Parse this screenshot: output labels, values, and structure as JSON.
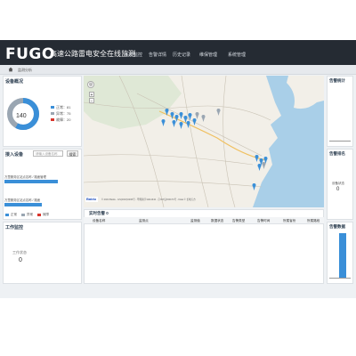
{
  "header": {
    "logo": "FUGO",
    "app_title": "高速公路雷电安全在线监测",
    "nav_items": [
      "系统监控",
      "告警详情",
      "历史记录",
      "维保管理",
      "系统管理"
    ]
  },
  "breadcrumb": {
    "label": "监测分析"
  },
  "device_overview": {
    "title": "设备概况",
    "total": "140",
    "legend": [
      {
        "label": "正常：81",
        "color": "#3a8fd8"
      },
      {
        "label": "异常：75",
        "color": "#9aa6b2"
      },
      {
        "label": "故障：20",
        "color": "#d9342b"
      }
    ],
    "donut_fraction": 0.58
  },
  "access_devices": {
    "title": "接入设备",
    "input_placeholder": "请输入设备名称",
    "search_label": "搜索",
    "rows": [
      {
        "label": "万里服务区站点名称 / 路面管理",
        "value_fraction": 1.0
      },
      {
        "label": "万里服务区站点名称 / 路面",
        "value_fraction": 0.7
      }
    ],
    "legend": [
      {
        "label": "正常",
        "color": "#3a8fd8"
      },
      {
        "label": "异常",
        "color": "#9aa6b2"
      },
      {
        "label": "故障",
        "color": "#d9342b"
      }
    ]
  },
  "work_status": {
    "title": "工作监控",
    "label": "工作状态",
    "value": "0"
  },
  "map": {
    "zoom_in": "+",
    "zoom_out": "−",
    "brand": "Baidu",
    "copyright": "© 2024 Baidu - GS(2023)3206号 - 甲测资字11111342 - 京ICP证030173号 - Data © 长地万方"
  },
  "realtime_table": {
    "title": "实时告警 0",
    "columns": [
      "设备名称",
      "监测点",
      "监测值",
      "数据状态",
      "告警类型",
      "告警时间",
      "所属省份",
      "所属路段"
    ]
  },
  "right_panels": {
    "alarm_count_title": "告警统计",
    "alarm_rank_title": "告警排名",
    "device_status_label": "设备状态",
    "device_status_value": "0",
    "alarm_chart_title": "告警数据"
  }
}
